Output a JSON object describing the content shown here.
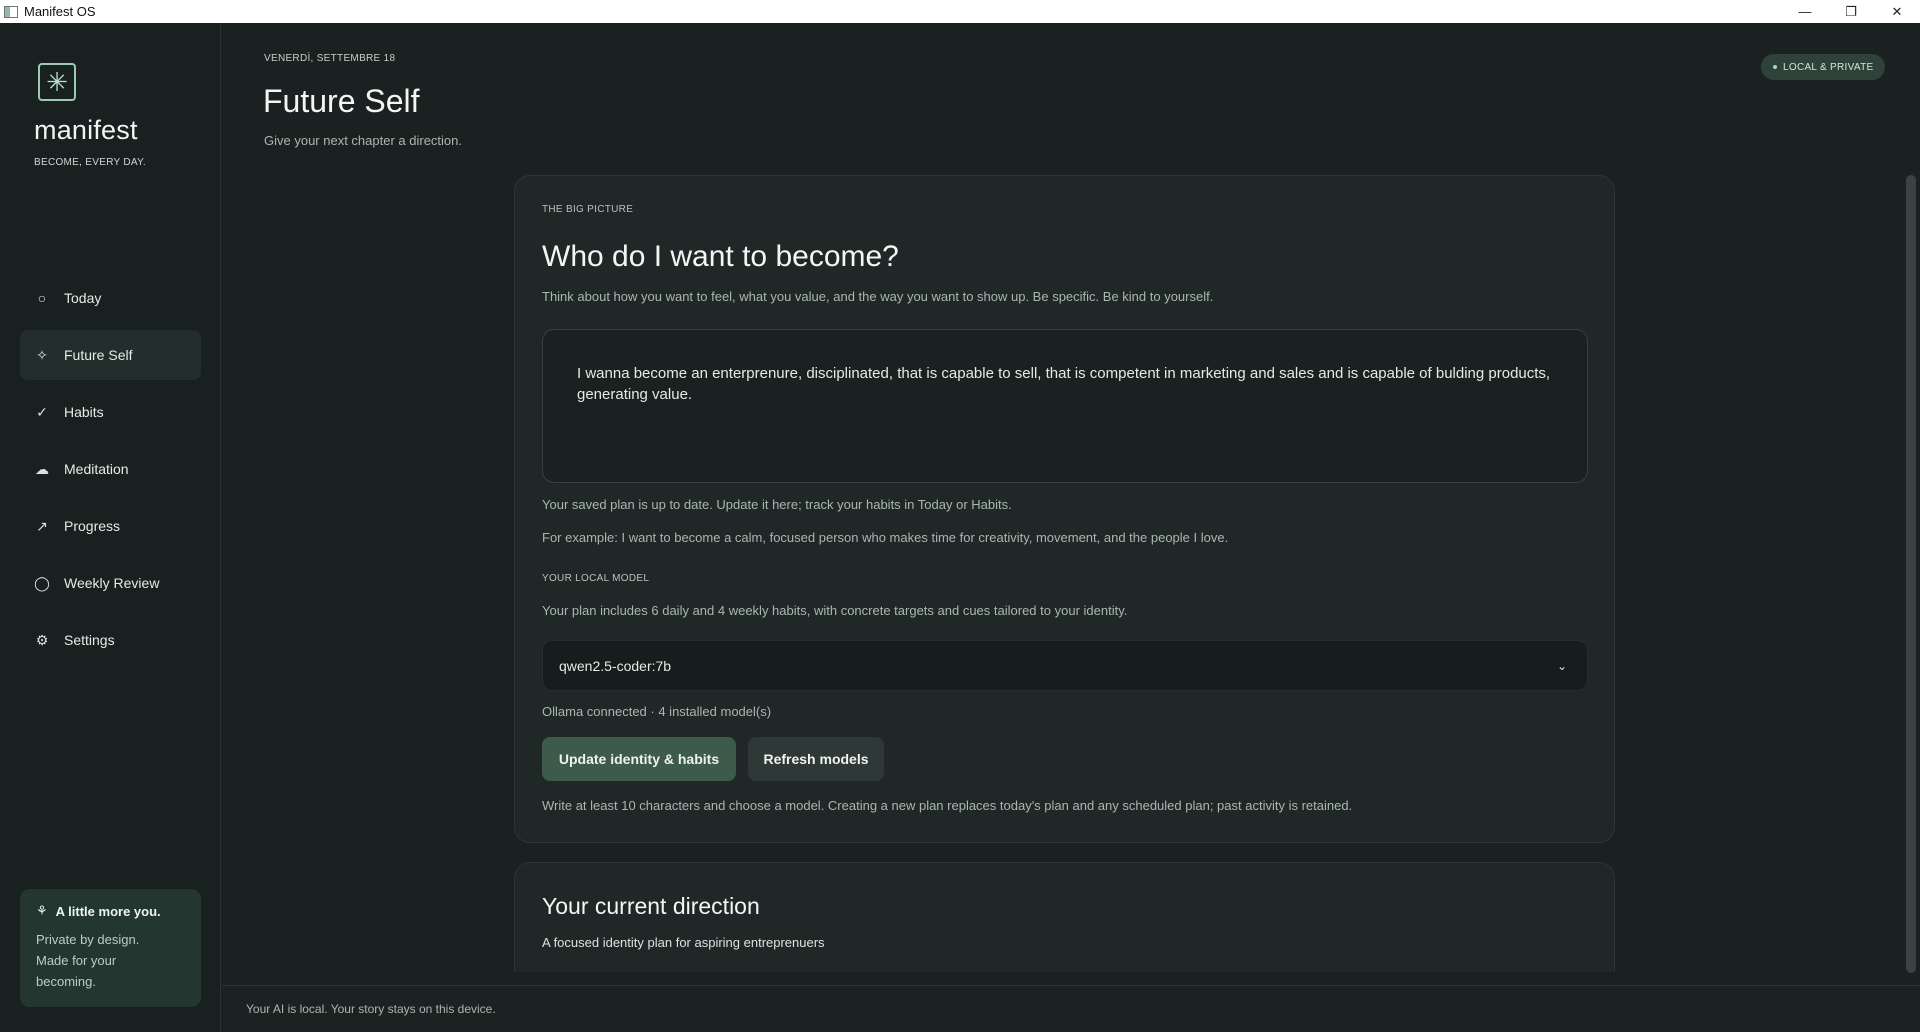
{
  "window": {
    "title": "Manifest OS",
    "controls": {
      "minimize": "—",
      "maximize": "❐",
      "close": "✕"
    }
  },
  "sidebar": {
    "brand": {
      "icon": "sparkle-icon",
      "name": "manifest",
      "tagline": "BECOME, EVERY DAY."
    },
    "items": [
      {
        "label": "Today",
        "icon": "circle-icon",
        "glyph": "○",
        "active": false
      },
      {
        "label": "Future Self",
        "icon": "sparkle-icon",
        "glyph": "✧",
        "active": true
      },
      {
        "label": "Habits",
        "icon": "check-icon",
        "glyph": "✓",
        "active": false
      },
      {
        "label": "Meditation",
        "icon": "cloud-icon",
        "glyph": "☁",
        "active": false
      },
      {
        "label": "Progress",
        "icon": "trend-arrow-icon",
        "glyph": "↗",
        "active": false
      },
      {
        "label": "Weekly Review",
        "icon": "ring-icon",
        "glyph": "◯",
        "active": false
      },
      {
        "label": "Settings",
        "icon": "gear-icon",
        "glyph": "⚙",
        "active": false
      }
    ],
    "promo": {
      "icon": "plant-icon",
      "title": "A little more you.",
      "text": "Private by design. Made for your becoming."
    }
  },
  "header": {
    "date": "VENERDÌ, SETTEMBRE 18",
    "title": "Future Self",
    "subtitle": "Give your next chapter a direction.",
    "badge": "LOCAL & PRIVATE"
  },
  "identity_card": {
    "eyebrow": "THE BIG PICTURE",
    "heading": "Who do I want to become?",
    "lead": "Think about how you want to feel, what you value, and the way you want to show up. Be specific. Be kind to yourself.",
    "identity_text": "I wanna become an enterprenure, disciplinated, that is capable to sell, that is competent in marketing and sales and is capable of bulding products, generating value.",
    "saved_note": "Your saved plan is up to date. Update it here; track your habits in Today or Habits.",
    "example": "For example: I want to become a calm, focused person who makes time for creativity, movement, and the people I love.",
    "model_label": "YOUR LOCAL MODEL",
    "plan_info": "Your plan includes 6 daily and 4 weekly habits, with concrete targets and cues tailored to your identity.",
    "model_select": "qwen2.5-coder:7b",
    "connection_status": "Ollama connected · 4 installed model(s)",
    "primary_button": "Update identity & habits",
    "secondary_button": "Refresh models",
    "footnote": "Write at least 10 characters and choose a model. Creating a new plan replaces today's plan and any scheduled plan; past activity is retained."
  },
  "direction_card": {
    "heading": "Your current direction",
    "subtitle": "A focused identity plan for aspiring entreprenuers"
  },
  "footer": {
    "text": "Your AI is local. Your story stays on this device."
  },
  "colors": {
    "background": "#1a2120",
    "sidebar": "#182120",
    "card": "#1f2827",
    "accent_button": "#3d5a4a",
    "badge": "#2e423a"
  }
}
